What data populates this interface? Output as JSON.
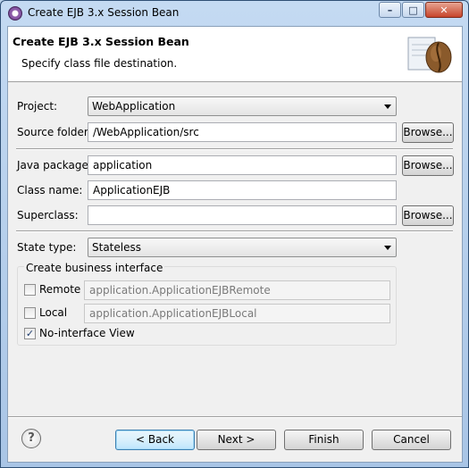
{
  "window": {
    "title": "Create EJB 3.x Session Bean",
    "controls": {
      "minimize": "–",
      "maximize": "□",
      "close": "✕"
    }
  },
  "header": {
    "title": "Create EJB 3.x Session Bean",
    "subtitle": "Specify class file destination.",
    "graphic": "coffee-bean-icon"
  },
  "form": {
    "project": {
      "label": "Project:",
      "value": "WebApplication"
    },
    "source_folder": {
      "label": "Source folder:",
      "value": "/WebApplication/src",
      "browse": "Browse..."
    },
    "java_package": {
      "label": "Java package:",
      "value": "application",
      "browse": "Browse..."
    },
    "class_name": {
      "label": "Class name:",
      "value": "ApplicationEJB"
    },
    "superclass": {
      "label": "Superclass:",
      "value": "",
      "browse": "Browse..."
    },
    "state_type": {
      "label": "State type:",
      "value": "Stateless"
    }
  },
  "business_interface": {
    "legend": "Create business interface",
    "remote": {
      "label": "Remote",
      "checked": false,
      "value": "application.ApplicationEJBRemote"
    },
    "local": {
      "label": "Local",
      "checked": false,
      "value": "application.ApplicationEJBLocal"
    },
    "no_interface": {
      "label": "No-interface View",
      "checked": true,
      "mark": "✓"
    }
  },
  "footer": {
    "help": "?",
    "back": "< Back",
    "next": "Next >",
    "finish": "Finish",
    "cancel": "Cancel"
  }
}
